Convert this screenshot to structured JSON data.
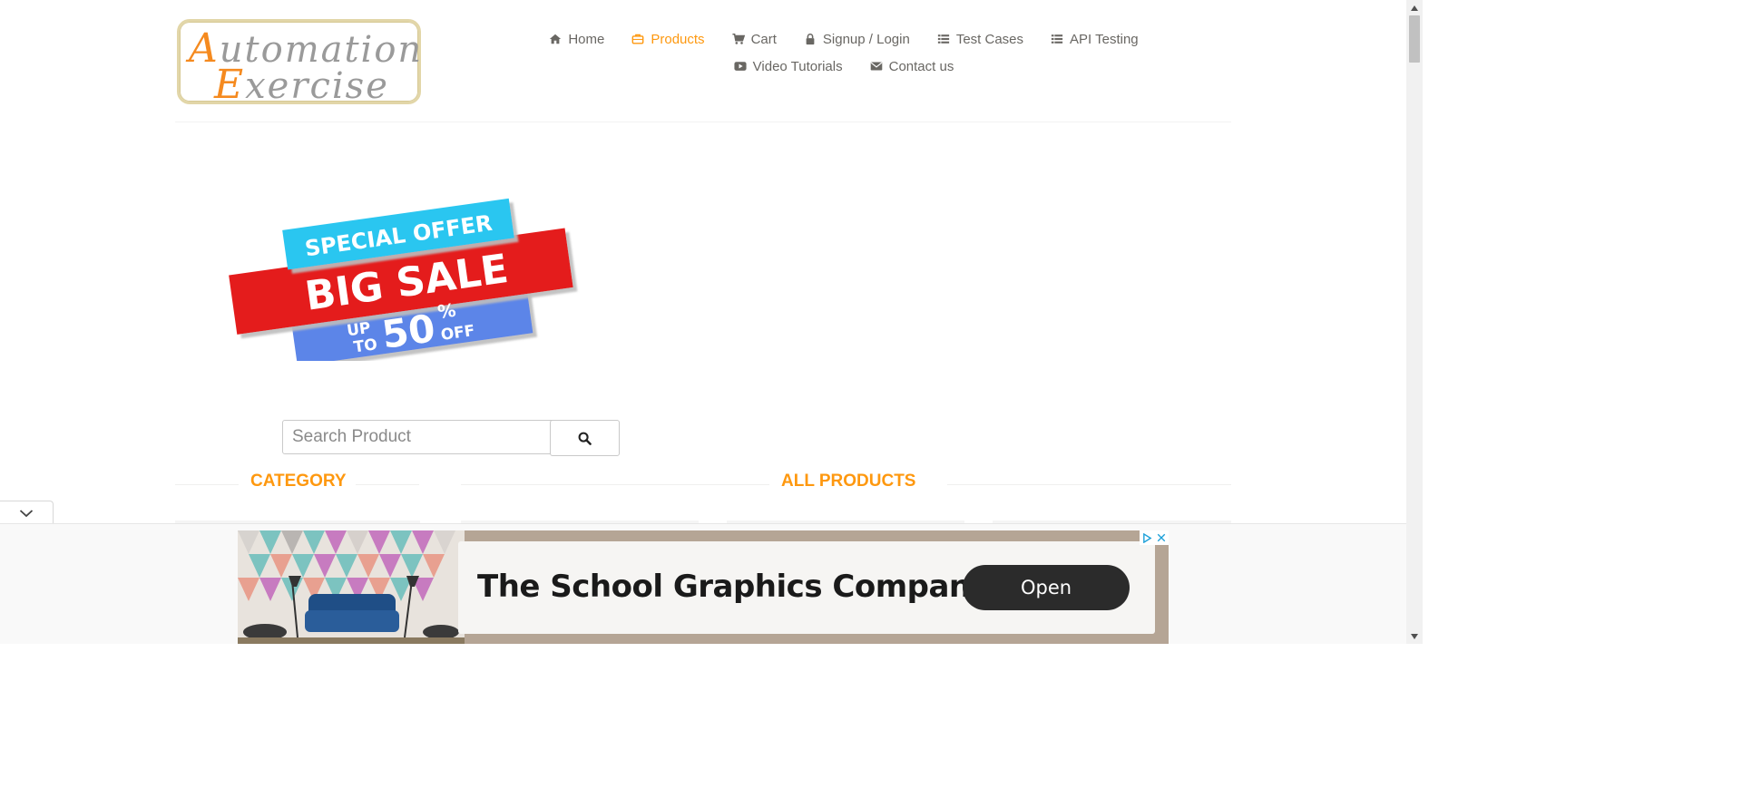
{
  "logo": {
    "line1_cap": "A",
    "line1_rest": "utomation",
    "line2_cap": "E",
    "line2_rest": "xercise"
  },
  "nav": {
    "items": [
      {
        "label": "Home",
        "icon": "home-icon"
      },
      {
        "label": "Products",
        "icon": "briefcase-icon",
        "active": true
      },
      {
        "label": "Cart",
        "icon": "cart-icon"
      },
      {
        "label": "Signup / Login",
        "icon": "lock-icon"
      },
      {
        "label": "Test Cases",
        "icon": "list-icon"
      },
      {
        "label": "API Testing",
        "icon": "list-icon"
      },
      {
        "label": "Video Tutorials",
        "icon": "youtube-play-icon"
      },
      {
        "label": "Contact us",
        "icon": "envelope-icon"
      }
    ],
    "active_color": "#fe980f"
  },
  "banner": {
    "line1": "SPECIAL OFFER",
    "line2": "BIG SALE",
    "up": "UP",
    "to": "TO",
    "amount": "50",
    "percent": "%",
    "off": "OFF",
    "colors": {
      "cyan": "#2cc6f0",
      "red": "#e41e1e",
      "blue": "#5b85e8"
    }
  },
  "search": {
    "placeholder": "Search Product",
    "icon": "search-icon"
  },
  "sections": {
    "category": "CATEGORY",
    "all_products": "ALL PRODUCTS"
  },
  "ad": {
    "headline": "The School Graphics Company",
    "cta": "Open",
    "choices_icons": [
      "adchoices-icon",
      "close-icon"
    ]
  },
  "collapse_tab": {
    "icon": "chevron-down-icon"
  }
}
